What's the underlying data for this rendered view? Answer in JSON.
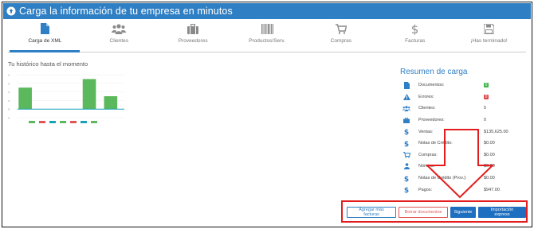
{
  "header": {
    "title": "Carga la información de tu empresa en minutos",
    "color": "#2f7fc4"
  },
  "steps": [
    {
      "label": "Carga de XML",
      "icon": "file-icon",
      "active": true
    },
    {
      "label": "Clientes",
      "icon": "users-icon",
      "active": false
    },
    {
      "label": "Proveedores",
      "icon": "briefcase-icon",
      "active": false
    },
    {
      "label": "Productos/Serv.",
      "icon": "barcode-icon",
      "active": false
    },
    {
      "label": "Compras",
      "icon": "cart-icon",
      "active": false
    },
    {
      "label": "Facturas",
      "icon": "dollar-icon",
      "active": false
    },
    {
      "label": "¡Has terminado!",
      "icon": "save-icon",
      "active": false
    }
  ],
  "history": {
    "title": "Tu histórico hasta el momento"
  },
  "summary": {
    "title": "Resumen de carga",
    "rows": [
      {
        "icon": "file-icon",
        "label": "Documentos:",
        "badge": "0",
        "badge_color": "#3cb54a"
      },
      {
        "icon": "warning-icon",
        "label": "Errores:",
        "badge": "0",
        "badge_color": "#e04848"
      },
      {
        "icon": "users-icon",
        "label": "Clientes:",
        "value": "5"
      },
      {
        "icon": "briefcase-icon",
        "label": "Proveedores:",
        "value": "0"
      },
      {
        "icon": "dollar-icon",
        "label": "Ventas:",
        "value": "$135,625.00"
      },
      {
        "icon": "dollar-icon",
        "label": "Notas de Crédito:",
        "value": "$0.00"
      },
      {
        "icon": "cart-icon",
        "label": "Compras:",
        "value": "$0.00"
      },
      {
        "icon": "user-icon",
        "label": "Nómina:",
        "value": "$0.00"
      },
      {
        "icon": "dollar-icon",
        "label": "Notas de Crédito (Prov.):",
        "value": "$0.00"
      },
      {
        "icon": "dollar-icon",
        "label": "Pagos:",
        "value": "$947.00"
      }
    ]
  },
  "buttons": {
    "add_invoices": "Agregar más facturas",
    "delete_documents": "Borrar documentos",
    "next": "Siguiente",
    "express_import": "Importación express"
  },
  "chart_data": {
    "type": "bar",
    "values": [
      5,
      0,
      0,
      7,
      3
    ],
    "annotation_colors": [
      "#5cb85c",
      "#17a2b8",
      "#e05555"
    ],
    "ylim": [
      -2,
      8
    ]
  },
  "colors": {
    "accent": "#2f7fc4",
    "highlight": "#e31d1d",
    "bar": "#5cb85c"
  }
}
